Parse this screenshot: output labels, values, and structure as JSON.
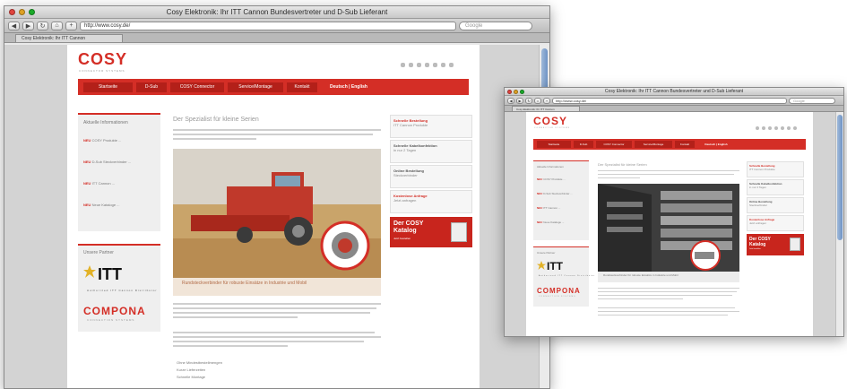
{
  "browser": {
    "title": "Cosy Elektronik: Ihr ITT Cannon Bundesvertreter und D-Sub Lieferant",
    "url": "http://www.cosy.de/",
    "tab": "Cosy Elektronik: Ihr ITT Cannon",
    "search_placeholder": "Google"
  },
  "site": {
    "logo": "COSY",
    "logo_sub": "CONNECTOR SYSTEMS",
    "nav": [
      "Startseite",
      "D-Sub",
      "COSY Connector",
      "Service/Montage",
      "Kontakt",
      "Deutsch | English"
    ],
    "headline": "Der Spezialist für kleine Serien",
    "sidebar_heading": "Aktuelle Informationen",
    "partner_heading": "Unsere Partner",
    "news": [
      {
        "tag": "NEU",
        "text": "COSY Produkte ..."
      },
      {
        "tag": "NEU",
        "text": "D-Sub Steckverbinder ..."
      },
      {
        "tag": "NEU",
        "text": "ITT Cannon ..."
      },
      {
        "tag": "NEU",
        "text": "Neue Kataloge ..."
      }
    ],
    "promos": [
      {
        "title": "Schnelle Bestellung",
        "desc": "ITT Cannon Produkte"
      },
      {
        "title": "Schnelle Kabelkonfektion",
        "desc": "in nur 2 Tagen"
      },
      {
        "title": "Online Bestellung",
        "desc": "Steckverbinder"
      },
      {
        "title": "Kostenlose Anfrage",
        "desc": "Jetzt anfragen"
      }
    ],
    "katalog_title": "Der COSY Katalog",
    "katalog_link": "Jetzt bestellen",
    "caption": "Rundsteckverbinder für robuste Einsätze in Industrie und Mobil",
    "partners": {
      "itt": "ITT",
      "itt_sub": "Authorized ITT Cannon Distributor",
      "compona": "COMPONA",
      "compona_sub": "CONNECTION SYSTEMS"
    },
    "bullets": [
      "Ohne Mindestbestellmengen",
      "Kurze Lieferzeiten",
      "Schnelle Montage"
    ]
  }
}
